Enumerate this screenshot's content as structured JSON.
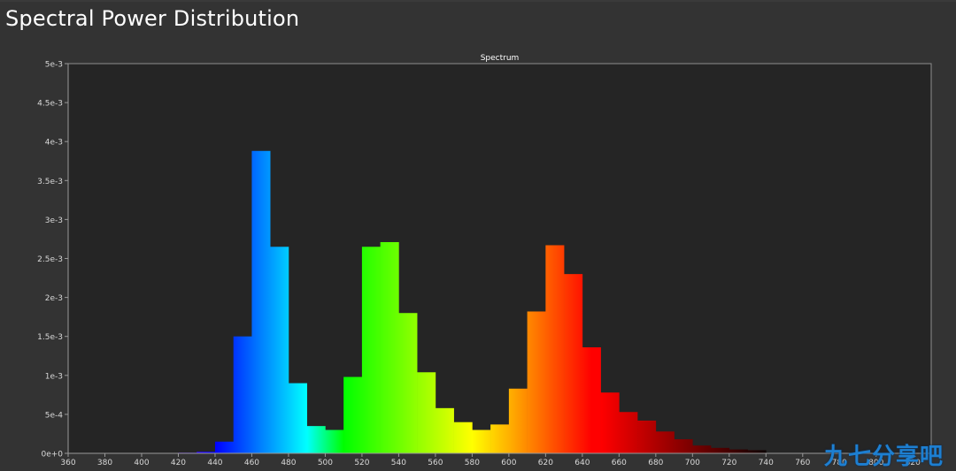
{
  "page": {
    "title": "Spectral Power Distribution",
    "watermark": "九七分享吧"
  },
  "colors": {
    "background": "#333333",
    "plot_background": "#252525",
    "axis": "#9a9a9a",
    "text": "#ffffff"
  },
  "chart_data": {
    "type": "bar",
    "title": "Spectrum",
    "xlabel": "",
    "ylabel": "",
    "xlim": [
      360,
      830
    ],
    "ylim": [
      0,
      0.005
    ],
    "x_ticks": [
      360,
      380,
      400,
      420,
      440,
      460,
      480,
      500,
      520,
      540,
      560,
      580,
      600,
      620,
      640,
      660,
      680,
      700,
      720,
      740,
      760,
      780,
      800,
      820
    ],
    "y_ticks": [
      0,
      0.0005,
      0.001,
      0.0015,
      0.002,
      0.0025,
      0.003,
      0.0035,
      0.004,
      0.0045,
      0.005
    ],
    "y_tick_labels": [
      "0e+0",
      "5e-4",
      "1e-3",
      "1.5e-3",
      "2e-3",
      "2.5e-3",
      "3e-3",
      "3.5e-3",
      "4e-3",
      "4.5e-3",
      "5e-3"
    ],
    "bin_width": 10,
    "x": [
      400,
      410,
      420,
      430,
      440,
      450,
      460,
      470,
      480,
      490,
      500,
      510,
      520,
      530,
      540,
      550,
      560,
      570,
      580,
      590,
      600,
      610,
      620,
      630,
      640,
      650,
      660,
      670,
      680,
      690,
      700,
      710,
      720,
      730
    ],
    "values": [
      3e-06,
      5e-06,
      8e-06,
      2e-05,
      0.00015,
      0.0015,
      0.00388,
      0.00265,
      0.0009,
      0.00035,
      0.0003,
      0.00098,
      0.00265,
      0.00271,
      0.0018,
      0.00104,
      0.00058,
      0.0004,
      0.0003,
      0.00037,
      0.00083,
      0.00182,
      0.00267,
      0.0023,
      0.00136,
      0.00078,
      0.00053,
      0.00042,
      0.00028,
      0.00018,
      0.0001,
      7e-05,
      5e-05,
      4e-05
    ],
    "grid": false,
    "legend": "none"
  }
}
